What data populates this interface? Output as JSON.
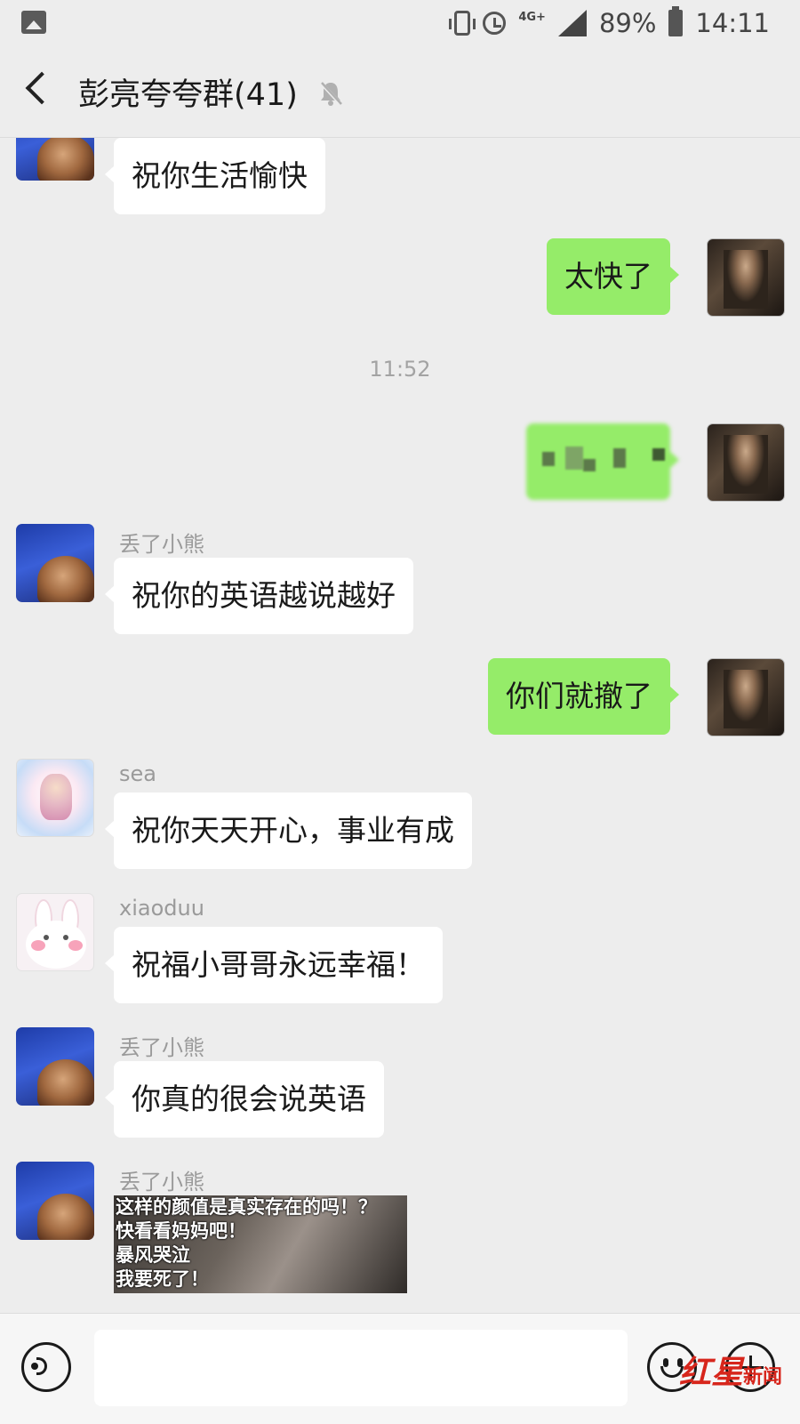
{
  "status_bar": {
    "network": "4G+",
    "battery": "89%",
    "time": "14:11"
  },
  "header": {
    "title": "彭亮夸夸群(41)"
  },
  "messages": [
    {
      "side": "in",
      "sender": "",
      "text": "祝你生活愉快"
    },
    {
      "side": "out",
      "text": "太快了"
    },
    {
      "type": "time",
      "text": "11:52"
    },
    {
      "side": "out",
      "text": "",
      "blurred": true
    },
    {
      "side": "in",
      "sender": "丢了小熊",
      "text": "祝你的英语越说越好"
    },
    {
      "side": "out",
      "text": "你们就撤了"
    },
    {
      "side": "in",
      "sender": "sea",
      "text": "祝你天天开心，事业有成"
    },
    {
      "side": "in",
      "sender": "xiaoduu",
      "text": "祝福小哥哥永远幸福！"
    },
    {
      "side": "in",
      "sender": "丢了小熊",
      "text": "你真的很会说英语"
    },
    {
      "side": "in",
      "sender": "丢了小熊",
      "type": "image",
      "caption_lines": [
        "这样的颜值是真实存在的吗！？",
        "快看看妈妈吧！",
        "暴风哭泣",
        "我要死了！"
      ]
    }
  ],
  "bottom_bar": {
    "input_value": ""
  },
  "watermark": {
    "brand": "红星",
    "sub": "新闻"
  }
}
